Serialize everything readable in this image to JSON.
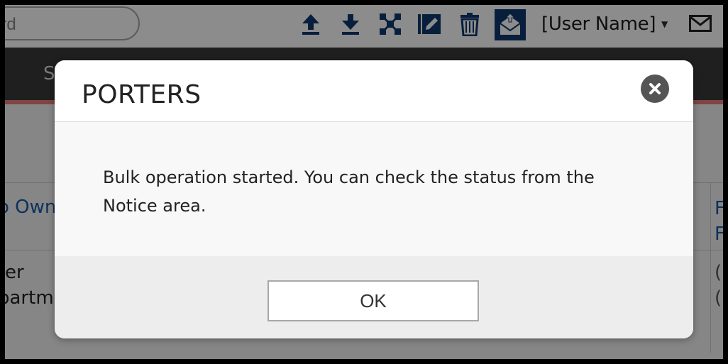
{
  "topbar": {
    "search_placeholder_visible": "eeword",
    "user_name": "[User Name]",
    "icons": [
      "upload-icon",
      "download-icon",
      "merge-icon",
      "edit-icon",
      "trash-icon",
      "bulk-mail-icon",
      "mail-icon"
    ],
    "accent_color": "#0e3a6e"
  },
  "navbar": {
    "visible_item": "S",
    "accent_line_color": "#e77e7c"
  },
  "table": {
    "left_header_fragment": "o Own",
    "left_cell_line1": "er",
    "left_cell_line2": "partm",
    "right_header_line1": "F",
    "right_header_line2": "F",
    "right_cell_line1": "(",
    "right_cell_line2": "("
  },
  "modal": {
    "title": "PORTERS",
    "message": "Bulk operation started. You can check the status from the Notice area.",
    "ok_label": "OK"
  }
}
